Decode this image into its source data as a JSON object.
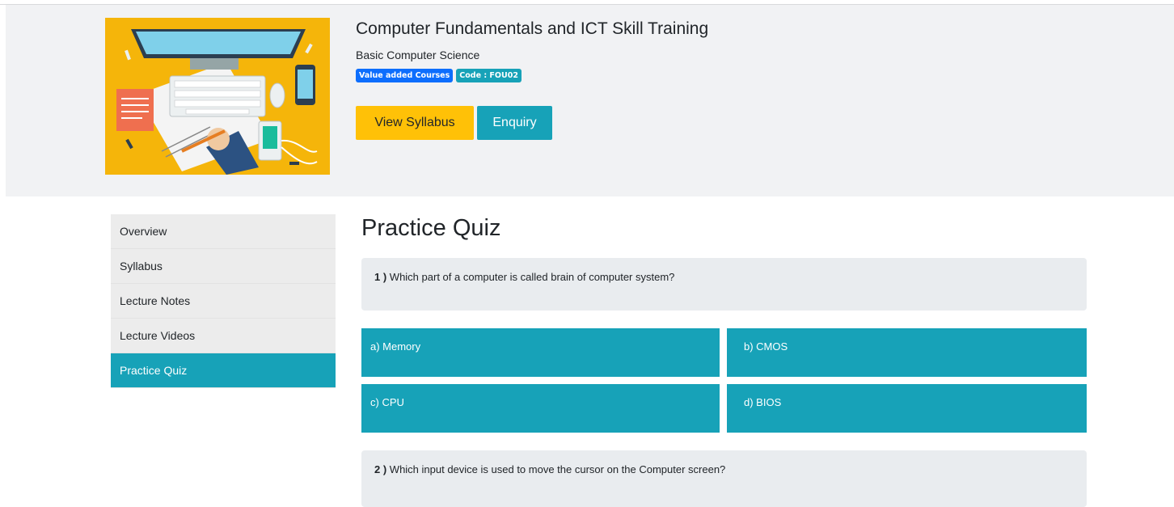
{
  "course": {
    "title": "Computer Fundamentals and ICT Skill Training",
    "subtitle": "Basic Computer Science",
    "badges": {
      "category": "Value added Courses",
      "code": "Code : FOU02"
    },
    "buttons": {
      "syllabus": "View Syllabus",
      "enquiry": "Enquiry"
    },
    "image_icon": "workspace-illustration"
  },
  "sidebar": {
    "items": [
      {
        "label": "Overview",
        "active": false
      },
      {
        "label": "Syllabus",
        "active": false
      },
      {
        "label": "Lecture Notes",
        "active": false
      },
      {
        "label": "Lecture Videos",
        "active": false
      },
      {
        "label": "Practice Quiz",
        "active": true
      }
    ]
  },
  "quiz": {
    "heading": "Practice Quiz",
    "questions": [
      {
        "number": "1 )",
        "text": "Which part of a computer is called brain of computer system?",
        "options": [
          "a) Memory",
          "b) CMOS",
          "c) CPU",
          "d) BIOS"
        ]
      },
      {
        "number": "2 )",
        "text": "Which input device is used to move the cursor on the Computer screen?"
      }
    ]
  },
  "colors": {
    "accent": "#17a2b8",
    "warning": "#ffc107",
    "primary": "#0d6efd",
    "hero_bg": "#f1f2f4",
    "thumb_bg": "#f5b50a"
  }
}
